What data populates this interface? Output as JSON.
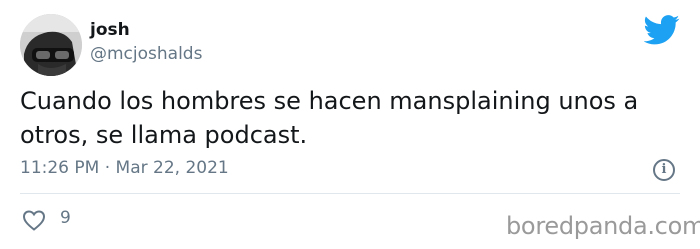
{
  "user": {
    "display_name": "josh",
    "handle": "@mcjoshalds",
    "avatar_icon": "avatar-photo"
  },
  "tweet": {
    "text": "Cuando los hombres se hacen mansplaining unos a otros, se llama podcast.",
    "timestamp": "11:26 PM · Mar 22, 2021",
    "like_count": "9",
    "info_icon_glyph": "i"
  },
  "icons": {
    "brand": "twitter-bird-icon",
    "like": "heart-icon",
    "info": "info-icon"
  },
  "colors": {
    "twitter_blue": "#1da1f2",
    "secondary_text": "#657786",
    "primary_text": "#14171a",
    "divider": "#e1e8ed"
  },
  "watermark": "boredpanda.com"
}
